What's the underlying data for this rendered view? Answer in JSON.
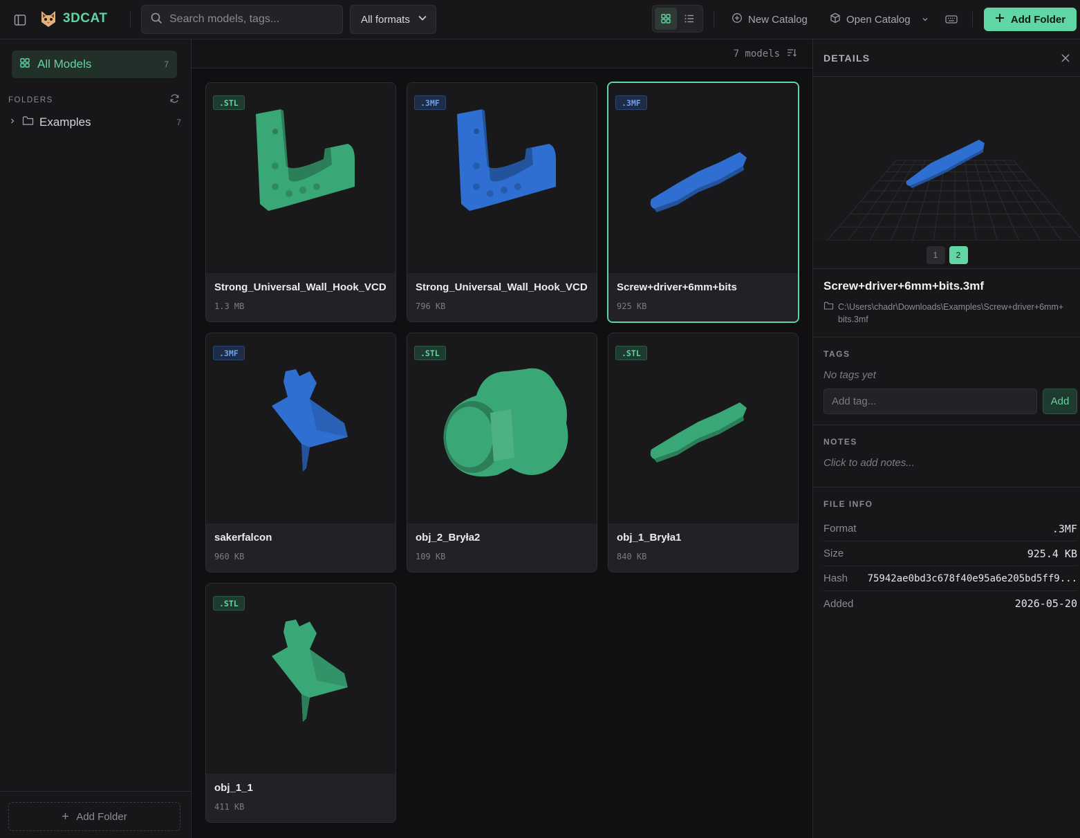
{
  "app": {
    "name": "3DCAT",
    "accent": "#5fd6a4",
    "secondary": "#4a86e8"
  },
  "toolbar": {
    "search_placeholder": "Search models, tags...",
    "format_select": "All formats",
    "new_catalog": "New Catalog",
    "open_catalog": "Open Catalog",
    "add_folder": "Add Folder",
    "view_mode": "grid"
  },
  "sidebar": {
    "all_models": {
      "label": "All Models",
      "count": "7"
    },
    "folders_title": "FOLDERS",
    "folders": [
      {
        "label": "Examples",
        "count": "7"
      }
    ],
    "add_folder": "Add Folder"
  },
  "main": {
    "count_label": "7 models",
    "models": [
      {
        "name": "Strong_Universal_Wall_Hook_VCD",
        "size": "1.3 MB",
        "format": ".STL",
        "color": "#3aa876",
        "shape": "hook",
        "selected": false
      },
      {
        "name": "Strong_Universal_Wall_Hook_VCD",
        "size": "796 KB",
        "format": ".3MF",
        "color": "#2f6fd1",
        "shape": "hook",
        "selected": false
      },
      {
        "name": "Screw+driver+6mm+bits",
        "size": "925 KB",
        "format": ".3MF",
        "color": "#2f6fd1",
        "shape": "rod",
        "selected": true
      },
      {
        "name": "sakerfalcon",
        "size": "960 KB",
        "format": ".3MF",
        "color": "#2f6fd1",
        "shape": "plane",
        "selected": false
      },
      {
        "name": "obj_2_Bryła2",
        "size": "109 KB",
        "format": ".STL",
        "color": "#3aa876",
        "shape": "knob",
        "selected": false
      },
      {
        "name": "obj_1_Bryła1",
        "size": "840 KB",
        "format": ".STL",
        "color": "#3aa876",
        "shape": "rod",
        "selected": false
      },
      {
        "name": "obj_1_1",
        "size": "411 KB",
        "format": ".STL",
        "color": "#3aa876",
        "shape": "plane",
        "selected": false
      }
    ]
  },
  "details": {
    "title": "DETAILS",
    "pages": [
      "1",
      "2"
    ],
    "active_page": "2",
    "file_name": "Screw+driver+6mm+bits.3mf",
    "path": "C:\\Users\\chadr\\Downloads\\Examples\\Screw+driver+6mm+bits.3mf",
    "tags_title": "TAGS",
    "no_tags": "No tags yet",
    "tag_placeholder": "Add tag...",
    "tag_add": "Add",
    "notes_title": "NOTES",
    "notes_placeholder": "Click to add notes...",
    "file_info_title": "FILE INFO",
    "file_info": [
      {
        "key": "Format",
        "value": ".3MF"
      },
      {
        "key": "Size",
        "value": "925.4 KB"
      },
      {
        "key": "Hash",
        "value": "75942ae0bd3c678f40e95a6e205bd5ff9..."
      },
      {
        "key": "Added",
        "value": "2026-05-20"
      }
    ]
  }
}
